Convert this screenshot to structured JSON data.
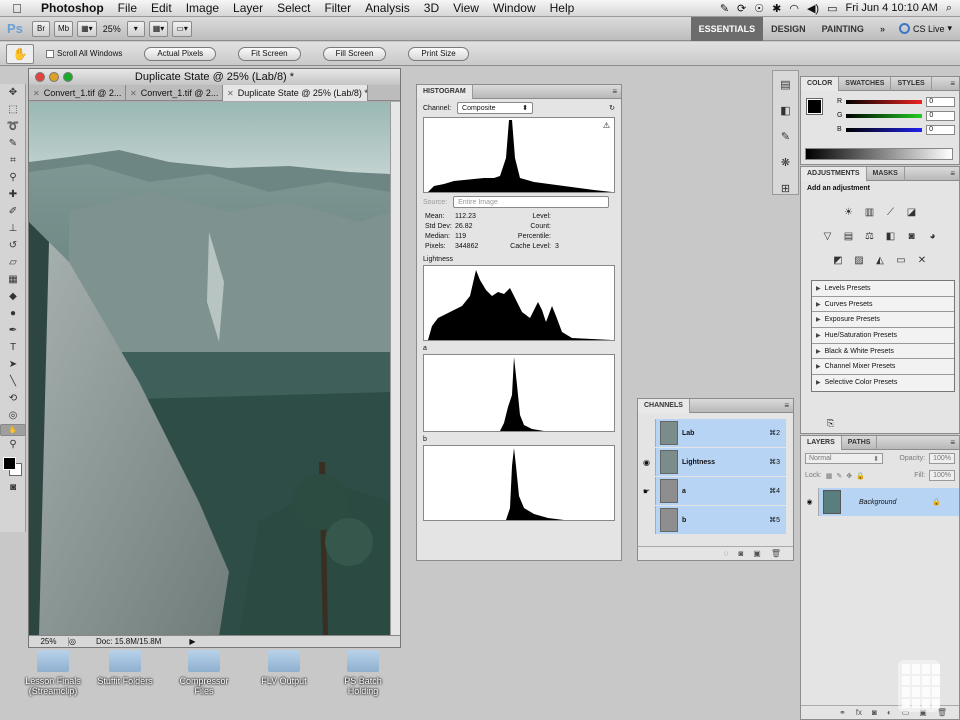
{
  "menubar": {
    "app": "Photoshop",
    "items": [
      "File",
      "Edit",
      "Image",
      "Layer",
      "Select",
      "Filter",
      "Analysis",
      "3D",
      "View",
      "Window",
      "Help"
    ],
    "clock": "Fri Jun 4  10:10 AM"
  },
  "appbar": {
    "logo": "Ps",
    "zoom": "25%",
    "workspaces": [
      "ESSENTIALS",
      "DESIGN",
      "PAINTING",
      "»"
    ],
    "cslive": "CS Live"
  },
  "options": {
    "scroll_all": "Scroll All Windows",
    "buttons": [
      "Actual Pixels",
      "Fit Screen",
      "Fill Screen",
      "Print Size"
    ]
  },
  "document": {
    "title": "Duplicate State @ 25% (Lab/8) *",
    "tabs": [
      "Convert_1.tif @ 2...",
      "Convert_1.tif @ 2...",
      "Duplicate State @ 25% (Lab/8) *"
    ],
    "zoom": "25%",
    "docinfo": "Doc: 15.8M/15.8M"
  },
  "desktop": [
    {
      "label": "Lesson Finals (Streamclip)"
    },
    {
      "label": "Stuffit Folders"
    },
    {
      "label": "Compressor Files"
    },
    {
      "label": "FLV Output"
    },
    {
      "label": "PS Batch Holding"
    }
  ],
  "histogram": {
    "title": "HISTOGRAM",
    "channel_label": "Channel:",
    "channel_value": "Composite",
    "source_label": "Source:",
    "source_value": "Entire Image",
    "stats": {
      "mean_label": "Mean:",
      "mean": "112.23",
      "std_label": "Std Dev:",
      "std": "26.82",
      "median_label": "Median:",
      "median": "119",
      "pixels_label": "Pixels:",
      "pixels": "344862",
      "level_label": "Level:",
      "count_label": "Count:",
      "percentile_label": "Percentile:",
      "cache_label": "Cache Level:",
      "cache": "3"
    },
    "channels": [
      "Lightness",
      "a",
      "b"
    ]
  },
  "channels_panel": {
    "title": "CHANNELS",
    "rows": [
      {
        "name": "Lab",
        "shortcut": "⌘2"
      },
      {
        "name": "Lightness",
        "shortcut": "⌘3"
      },
      {
        "name": "a",
        "shortcut": "⌘4"
      },
      {
        "name": "b",
        "shortcut": "⌘5"
      }
    ]
  },
  "color_panel": {
    "tabs": [
      "COLOR",
      "SWATCHES",
      "STYLES"
    ],
    "channels": [
      {
        "label": "R",
        "value": "0",
        "color": "#d22"
      },
      {
        "label": "G",
        "value": "0",
        "color": "#2b2"
      },
      {
        "label": "B",
        "value": "0",
        "color": "#22d"
      }
    ]
  },
  "adjustments_panel": {
    "tabs": [
      "ADJUSTMENTS",
      "MASKS"
    ],
    "title": "Add an adjustment",
    "presets": [
      "Levels Presets",
      "Curves Presets",
      "Exposure Presets",
      "Hue/Saturation Presets",
      "Black & White Presets",
      "Channel Mixer Presets",
      "Selective Color Presets"
    ]
  },
  "layers_panel": {
    "tabs": [
      "LAYERS",
      "PATHS"
    ],
    "blend_mode": "Normal",
    "opacity_label": "Opacity:",
    "opacity": "100%",
    "lock_label": "Lock:",
    "fill_label": "Fill:",
    "fill": "100%",
    "layer_name": "Background"
  },
  "colors": {
    "selection": "#b8d4f5",
    "accent": "#6a9fd6"
  }
}
